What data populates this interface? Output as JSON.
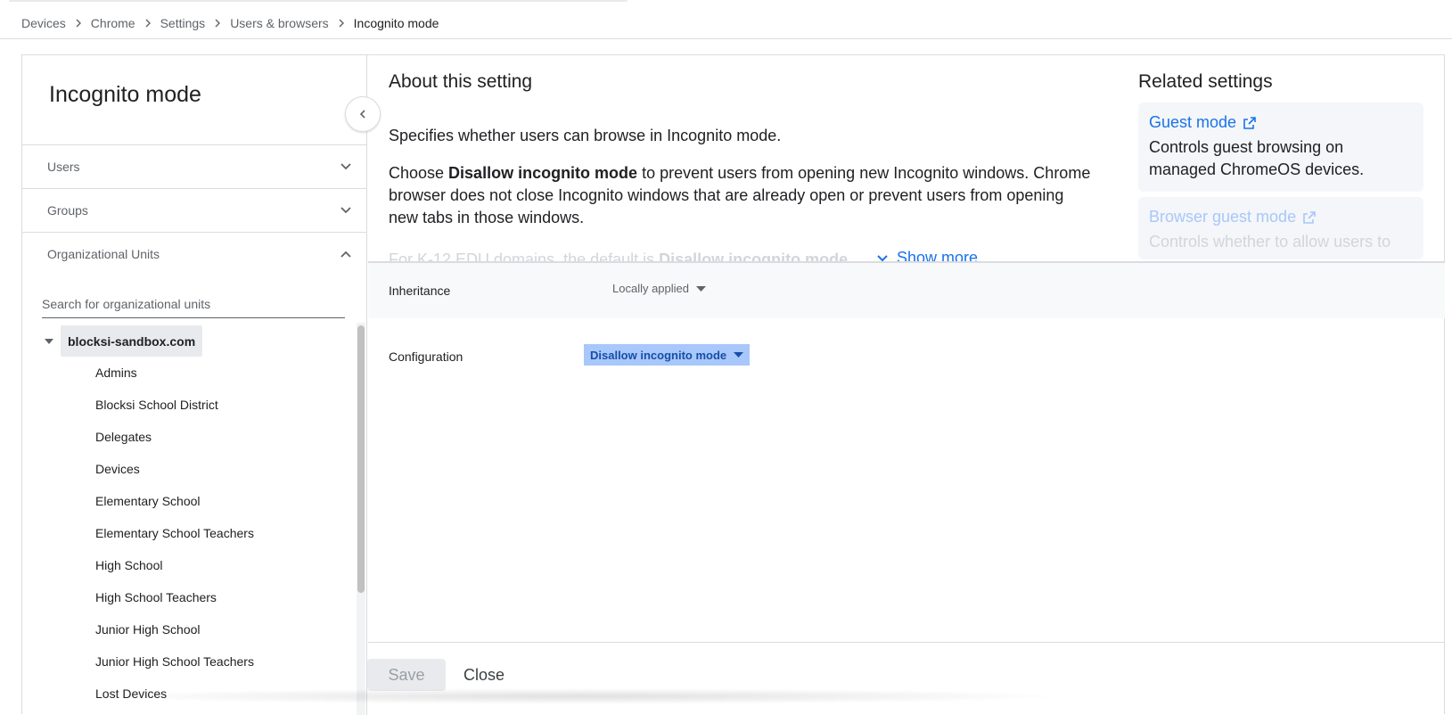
{
  "breadcrumb": {
    "items": [
      "Devices",
      "Chrome",
      "Settings",
      "Users & browsers"
    ],
    "current": "Incognito mode"
  },
  "left_panel": {
    "title": "Incognito mode",
    "sections": {
      "users": "Users",
      "groups": "Groups",
      "org_units": "Organizational Units"
    },
    "search_placeholder": "Search for organizational units",
    "root_unit": "blocksi-sandbox.com",
    "units": [
      "Admins",
      "Blocksi School District",
      "Delegates",
      "Devices",
      "Elementary School",
      "Elementary School Teachers",
      "High School",
      "High School Teachers",
      "Junior High School",
      "Junior High School Teachers",
      "Lost Devices"
    ]
  },
  "about": {
    "heading": "About this setting",
    "p1": "Specifies whether users can browse in Incognito mode.",
    "p2_pre": "Choose ",
    "p2_bold": "Disallow incognito mode",
    "p2_post": " to prevent users from opening new Incognito windows. Chrome browser does not close Incognito windows that are already open or prevent users from opening new tabs in those windows.",
    "p3_pre": "For K-12 EDU domains, the default is ",
    "p3_bold": "Disallow incognito mode",
    "p3_post": ".",
    "show_more": "Show more"
  },
  "related": {
    "heading": "Related settings",
    "items": [
      {
        "title": "Guest mode",
        "desc": "Controls guest browsing on managed ChromeOS devices."
      },
      {
        "title": "Browser guest mode",
        "desc": "Controls whether to allow users to"
      }
    ]
  },
  "settings": {
    "inheritance_label": "Inheritance",
    "inheritance_value": "Locally applied",
    "configuration_label": "Configuration",
    "configuration_value": "Disallow incognito mode"
  },
  "footer": {
    "save": "Save",
    "close": "Close"
  },
  "colors": {
    "accent": "#1a73e8",
    "highlight": "#a8c7fa",
    "border": "#dadce0"
  }
}
